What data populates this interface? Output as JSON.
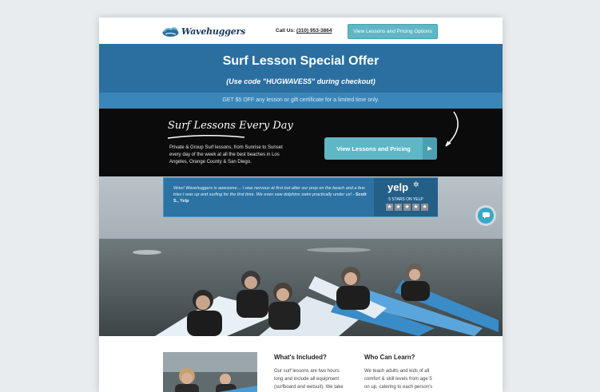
{
  "header": {
    "logo_text": "Wavehuggers",
    "call_label": "Call Us:",
    "phone": "(310) 953-3864",
    "button_label": "View Lessons and Pricing Options"
  },
  "offer": {
    "title": "Surf Lesson Special Offer",
    "code_line": "(Use code \"HUGWAVES5\" during checkout)",
    "strip_text": "GET $5 OFF any lesson or gift certificate for a limited time only."
  },
  "hero": {
    "title": "Surf Lessons Every Day",
    "description": "Private & Group Surf lessons, from Sunrise to Sunset every day of the week at all the best beaches in Los Angeles, Orange County & San Diego.",
    "cta_label": "View Lessons and Pricing",
    "cta_chevron": "▶"
  },
  "review": {
    "quote": "Wow! Wavehuggers is awesome… I was nervous at first but after our prep on the beach and a few tries I was up and surfing for the first time. We even saw dolphins swim practically under us!",
    "author": "- Scott S., Yelp",
    "yelp_logo": "yelp",
    "yelp_label": "5 STARS ON YELP",
    "stars": [
      "★",
      "★",
      "★",
      "★",
      "★"
    ]
  },
  "content": {
    "included_title": "What's Included?",
    "included_lines": [
      "Our surf lessons are two hours",
      "long and include all equipment",
      "(surfboard and wetsuit). We take"
    ],
    "who_title": "Who Can Learn?",
    "who_lines": [
      "We teach adults and kids of all",
      "comfort & skill levels from age 5",
      "on up, catering to each person's"
    ]
  },
  "colors": {
    "brand_blue": "#2a6fa0",
    "accent_teal": "#5fb7c6",
    "hero_black": "#0b0b0b"
  }
}
